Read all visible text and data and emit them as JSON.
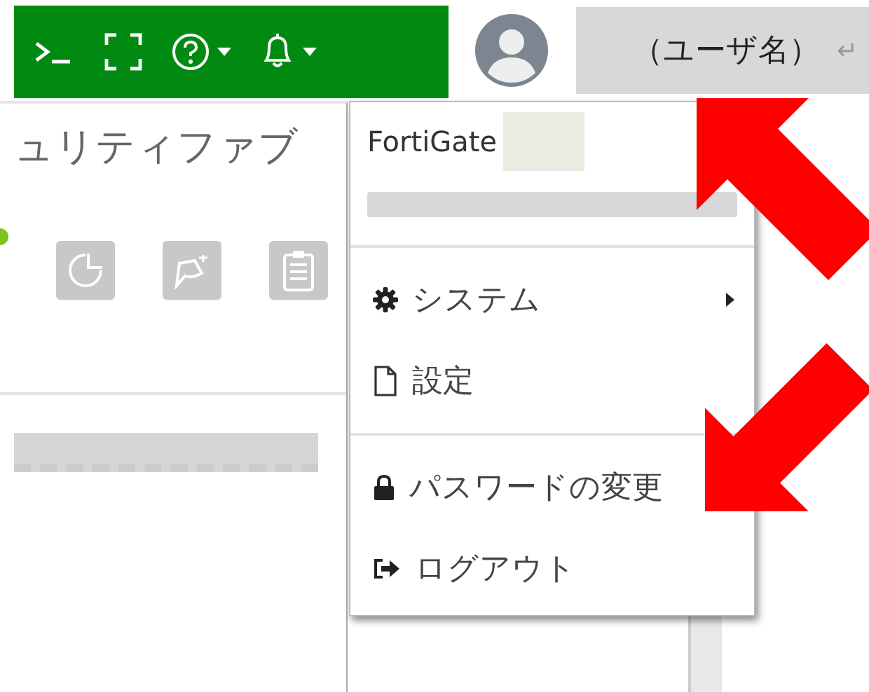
{
  "toolbar": {
    "buttons": [
      {
        "kind": "console",
        "dropdown": false
      },
      {
        "kind": "fullscreen",
        "dropdown": false
      },
      {
        "kind": "help",
        "dropdown": true
      },
      {
        "kind": "bell",
        "dropdown": true
      }
    ]
  },
  "user": {
    "name": "（ユーザ名）",
    "return_mark": "↵"
  },
  "dashboard": {
    "title": "ュリティファブ",
    "tiles": [
      {
        "kind": "clock"
      },
      {
        "kind": "tool"
      },
      {
        "kind": "clipboard"
      }
    ]
  },
  "menu": {
    "device": "FortiGate",
    "sections": [
      {
        "items": [
          {
            "kind": "gear",
            "label": "システム",
            "submenu": true
          },
          {
            "kind": "file",
            "label": "設定",
            "submenu": false
          }
        ]
      },
      {
        "items": [
          {
            "kind": "lock",
            "label": "パスワードの変更",
            "submenu": false
          },
          {
            "kind": "logout",
            "label": "ログアウト",
            "submenu": false
          }
        ]
      }
    ]
  },
  "annotations": [
    {
      "kind": "up_left_arrow"
    },
    {
      "kind": "down_left_arrow"
    }
  ]
}
